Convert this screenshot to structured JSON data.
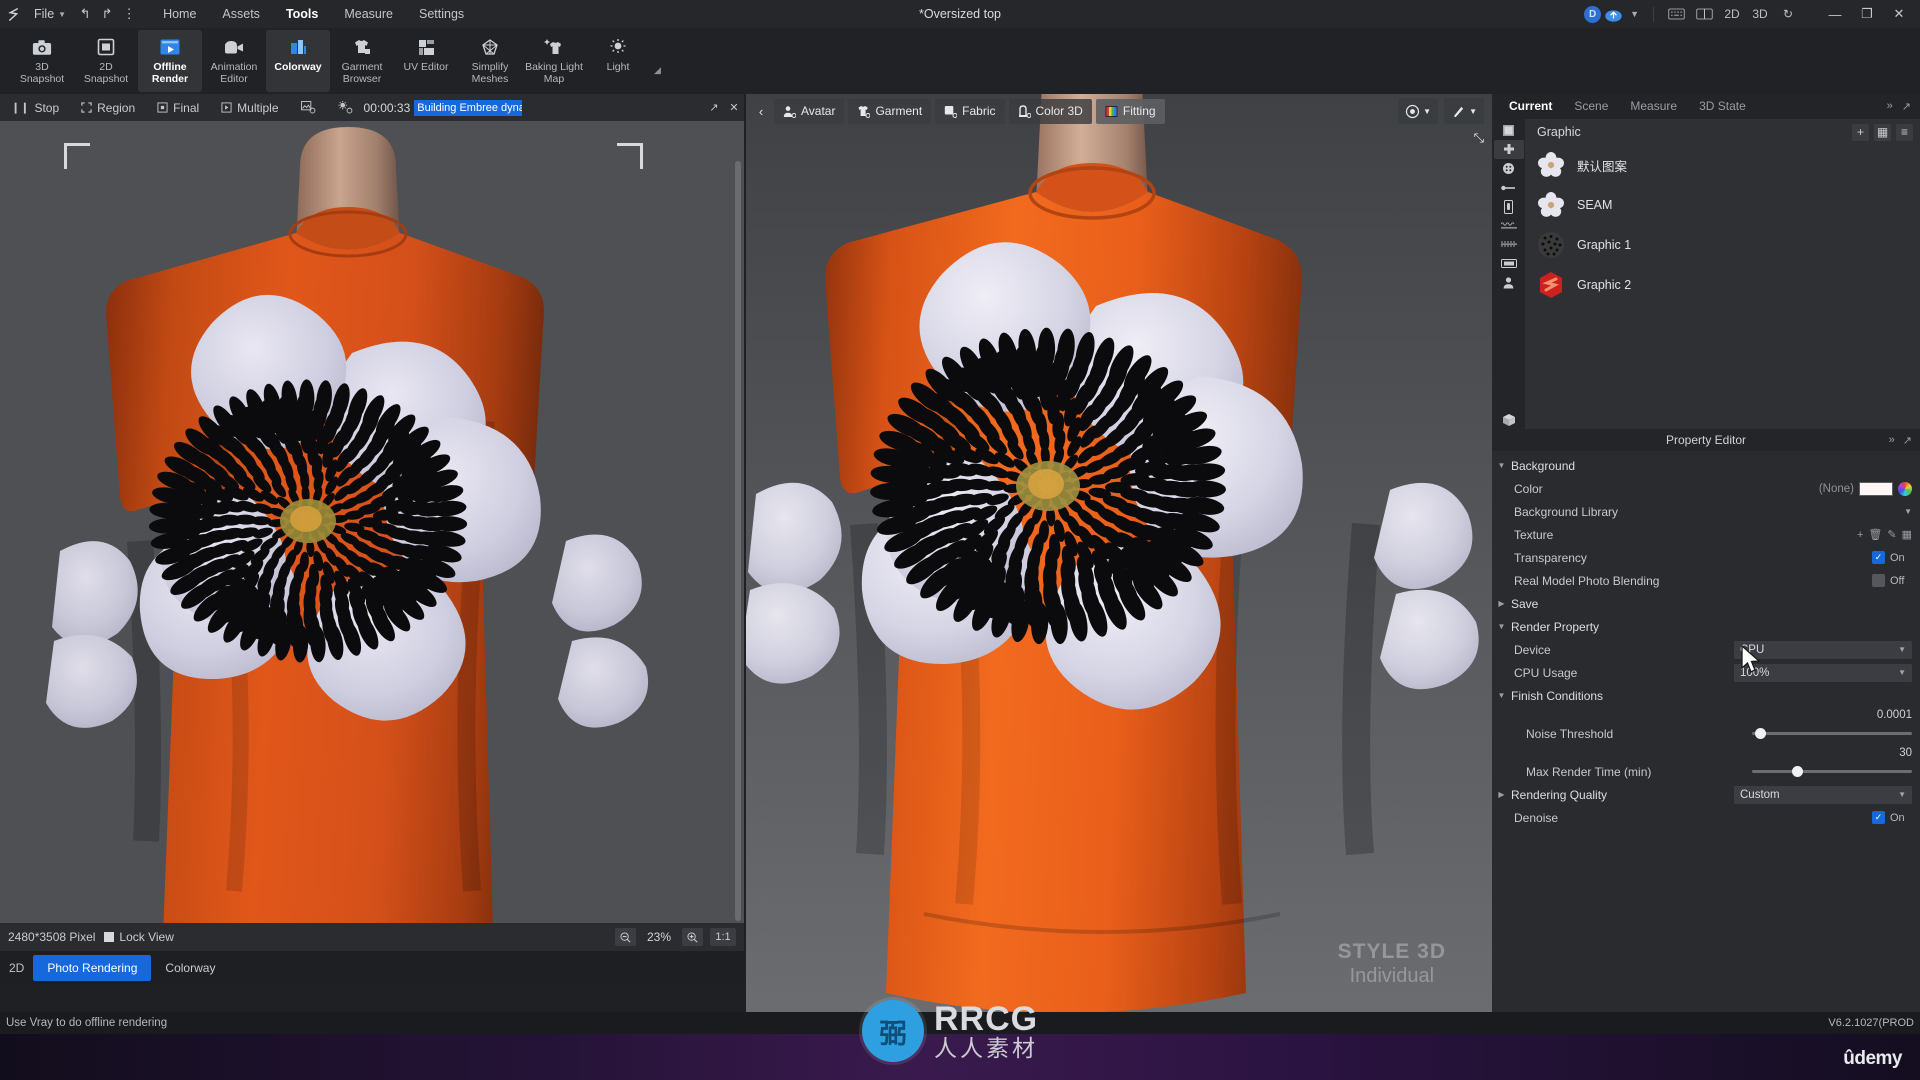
{
  "titlebar": {
    "file_menu": "File",
    "document_title": "*Oversized top",
    "menus": [
      {
        "label": "Home",
        "active": false
      },
      {
        "label": "Assets",
        "active": false
      },
      {
        "label": "Tools",
        "active": true
      },
      {
        "label": "Measure",
        "active": false
      },
      {
        "label": "Settings",
        "active": false
      }
    ],
    "account_badge": "D",
    "right_buttons": [
      {
        "name": "keyboard-shortcut-icon",
        "label": "⌨"
      },
      {
        "name": "layout-split-icon",
        "label": "◫"
      },
      {
        "name": "view-2d-button",
        "label": "2D"
      },
      {
        "name": "view-3d-button",
        "label": "3D"
      },
      {
        "name": "reset-view-icon",
        "label": "↻"
      }
    ],
    "window_controls": {
      "minimize": "—",
      "restore": "❐",
      "close": "✕"
    }
  },
  "ribbon": {
    "items": [
      {
        "label": "3D\nSnapshot",
        "icon": "camera-icon",
        "selected": false
      },
      {
        "label": "2D\nSnapshot",
        "icon": "screenshot-icon",
        "selected": false
      },
      {
        "label": "Offline\nRender",
        "icon": "offline-render-icon",
        "selected": true
      },
      {
        "label": "Animation\nEditor",
        "icon": "video-camera-icon",
        "selected": false
      },
      {
        "label": "Colorway",
        "icon": "colorway-icon",
        "selected": true
      },
      {
        "label": "Garment\nBrowser",
        "icon": "garment-browser-icon",
        "selected": false
      },
      {
        "label": "UV Editor",
        "icon": "uv-editor-icon",
        "selected": false
      },
      {
        "label": "Simplify\nMeshes",
        "icon": "simplify-meshes-icon",
        "selected": false
      },
      {
        "label": "Baking Light\nMap",
        "icon": "baking-light-map-icon",
        "selected": false
      },
      {
        "label": "Light",
        "icon": "light-bulb-icon",
        "selected": false
      }
    ]
  },
  "render_bar": {
    "stop_label": "Stop",
    "region_label": "Region",
    "final_label": "Final",
    "multiple_label": "Multiple",
    "elapsed_time": "00:00:33",
    "status_text": "Building Embree dynam",
    "status_color": "#1668dc",
    "expand_icon": "↗",
    "close_icon": "✕"
  },
  "canvas_2d": {
    "pixel_size": "2480*3508 Pixel",
    "lock_view_label": "Lock View",
    "lock_view_checked": true,
    "zoom_value": "23%",
    "zoom_out_icon": "zoom-out-icon",
    "zoom_in_icon": "zoom-in-icon",
    "fit_label": "1:1"
  },
  "bottom_tabs": {
    "left_label": "2D",
    "tabs": [
      {
        "label": "Photo Rendering",
        "active": true
      },
      {
        "label": "Colorway",
        "active": false
      }
    ]
  },
  "viewport": {
    "back_icon": "‹",
    "tabs": [
      {
        "label": "Avatar",
        "icon": "avatar-icon",
        "highlighted": false
      },
      {
        "label": "Garment",
        "icon": "garment-icon",
        "highlighted": false
      },
      {
        "label": "Fabric",
        "icon": "fabric-icon",
        "highlighted": false
      },
      {
        "label": "Color 3D",
        "icon": "color-3d-icon",
        "highlighted": false
      },
      {
        "label": "Fitting",
        "icon": "fitting-icon",
        "highlighted": true
      }
    ],
    "right_buttons": [
      {
        "name": "render-mode-icon",
        "label": "◉"
      },
      {
        "name": "brush-tool-icon",
        "label": "╱"
      }
    ],
    "expand_icon": "⤡",
    "watermark_line1": "STYLE 3D",
    "watermark_line2": "Individual"
  },
  "right_panel": {
    "tabs": [
      {
        "label": "Current",
        "active": true
      },
      {
        "label": "Scene",
        "active": false
      },
      {
        "label": "Measure",
        "active": false
      },
      {
        "label": "3D State",
        "active": false
      }
    ],
    "tab_actions": [
      "»",
      "⤡"
    ],
    "object_list": {
      "title": "Graphic",
      "actions": [
        {
          "name": "add-graphic-button",
          "label": "+"
        },
        {
          "name": "grid-view-button",
          "label": "▤"
        },
        {
          "name": "list-view-button",
          "label": "≡"
        }
      ],
      "rows": [
        {
          "name": "默认图案",
          "thumb": "flower"
        },
        {
          "name": "SEAM",
          "thumb": "flower"
        },
        {
          "name": "Graphic 1",
          "thumb": "dots"
        },
        {
          "name": "Graphic 2",
          "thumb": "logo"
        }
      ]
    },
    "side_icons": [
      {
        "name": "pattern-icon",
        "selected": false
      },
      {
        "name": "graphic-icon",
        "selected": true
      },
      {
        "name": "button-icon",
        "selected": false
      },
      {
        "name": "zipper-icon",
        "selected": false
      },
      {
        "name": "trim-icon",
        "selected": false
      },
      {
        "name": "stitch-icon",
        "selected": false
      },
      {
        "name": "topstitch-icon",
        "selected": false
      },
      {
        "name": "label-icon",
        "selected": false
      },
      {
        "name": "avatar-list-icon",
        "selected": false
      },
      {
        "name": "box-icon",
        "selected": false
      }
    ],
    "property_editor": {
      "title": "Property Editor",
      "header_actions": [
        "»",
        "⤡"
      ],
      "sections": [
        {
          "type": "group",
          "label": "Background",
          "expanded": true,
          "rows": [
            {
              "label": "Color",
              "control": "color",
              "value": "(None)",
              "swatch": "#fdf6f7"
            },
            {
              "label": "Background Library",
              "control": "dropdown-only",
              "value": ""
            },
            {
              "label": "Texture",
              "control": "icons",
              "icons": [
                "+",
                "🗑",
                "✎",
                "▦"
              ]
            },
            {
              "label": "Transparency",
              "control": "checkbox",
              "checked": true,
              "value": "On"
            },
            {
              "label": "Real Model Photo Blending",
              "control": "checkbox",
              "checked": false,
              "value": "Off"
            }
          ]
        },
        {
          "type": "group",
          "label": "Save",
          "expanded": false,
          "rows": []
        },
        {
          "type": "group",
          "label": "Render Property",
          "expanded": true,
          "rows": [
            {
              "label": "Device",
              "control": "combo",
              "value": "CPU"
            },
            {
              "label": "CPU Usage",
              "control": "combo",
              "value": "100%"
            }
          ]
        },
        {
          "type": "group",
          "label": "Finish Conditions",
          "expanded": true,
          "indent": 1,
          "rows": [
            {
              "label": "Noise Threshold",
              "control": "slider",
              "value": "0.0001",
              "knob_pct": 2
            },
            {
              "label": "Max Render Time (min)",
              "control": "slider",
              "value": "30",
              "knob_pct": 25
            }
          ]
        },
        {
          "type": "group",
          "label": "Rendering Quality",
          "expanded": false,
          "combo": "Custom",
          "rows": [
            {
              "label": "Denoise",
              "control": "checkbox",
              "checked": true,
              "value": "On"
            }
          ]
        }
      ]
    }
  },
  "status_bar": {
    "hint": "Use Vray to do offline rendering",
    "version": "V6.2.1027(PROD"
  },
  "overlays": {
    "rrcg_badge": "弼",
    "rrcg_text": "RRCG",
    "rrcg_cn": "人人素材",
    "udemy": "ûdemy"
  },
  "colors": {
    "accent_blue": "#1668dc",
    "garment_orange": "#e2571a",
    "panel_bg": "#2a2b2f",
    "viewport_bg": "#555a5e"
  }
}
